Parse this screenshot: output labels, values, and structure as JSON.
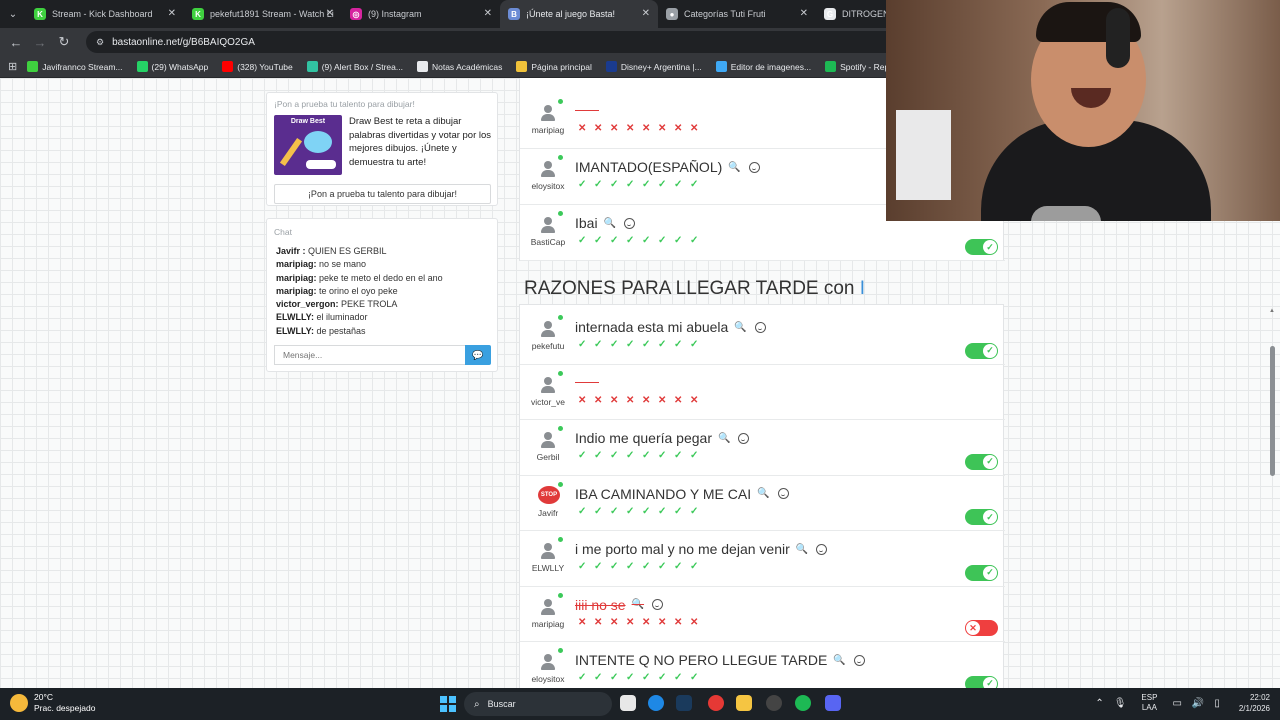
{
  "browser": {
    "tabs": [
      {
        "label": "Stream - Kick Dashboard",
        "fav_color": "#3fd13f",
        "fav_glyph": "K"
      },
      {
        "label": "pekefut1891 Stream - Watch Li",
        "fav_color": "#3fd13f",
        "fav_glyph": "K"
      },
      {
        "label": "(9) Instagram",
        "fav_color": "#d6249f",
        "fav_glyph": "◎"
      },
      {
        "label": "¡Únete al juego Basta!",
        "fav_color": "#6c8cd5",
        "fav_glyph": "B"
      },
      {
        "label": "Categorías Tuti Fruti",
        "fav_color": "#9aa0a6",
        "fav_glyph": "●"
      },
      {
        "label": "DITROGENO",
        "fav_color": "#e8eaed",
        "fav_glyph": "G"
      }
    ],
    "url": "bastaonline.net/g/B6BAIQO2GA",
    "bookmarks": [
      {
        "label": "Javifrannco Stream...",
        "color": "#3fd13f"
      },
      {
        "label": "(29) WhatsApp",
        "color": "#25d366"
      },
      {
        "label": "(328) YouTube",
        "color": "#ff0000"
      },
      {
        "label": "(9) Alert Box / Strea...",
        "color": "#31c3a2"
      },
      {
        "label": "Notas Académicas",
        "color": "#e8eaed"
      },
      {
        "label": "Página principal",
        "color": "#f0c23a"
      },
      {
        "label": "Disney+ Argentina |...",
        "color": "#1a3b8f"
      },
      {
        "label": "Editor de imagenes...",
        "color": "#3fa9f5"
      },
      {
        "label": "Spotify - Reproduct...",
        "color": "#1db954"
      }
    ]
  },
  "promo": {
    "title": "¡Pon a prueba tu talento para dibujar!",
    "image_title": "Draw Best",
    "text": "Draw Best te reta a dibujar palabras divertidas y votar por los mejores dibujos. ¡Únete y demuestra tu arte!",
    "button": "¡Pon a prueba tu talento para dibujar!"
  },
  "chat": {
    "title": "Chat",
    "messages": [
      {
        "user": "Javifr :",
        "text": " QUIEN ES GERBIL"
      },
      {
        "user": "maripiag:",
        "text": " no se mano"
      },
      {
        "user": "maripiag:",
        "text": " peke te meto el dedo en el ano"
      },
      {
        "user": "maripiag:",
        "text": " te orino el oyo peke"
      },
      {
        "user": "victor_vergon:",
        "text": " PEKE TROLA"
      },
      {
        "user": "ELWLLY:",
        "text": " el iluminador"
      },
      {
        "user": "ELWLLY:",
        "text": " de pestañas"
      }
    ],
    "placeholder": "Mensaje...",
    "send_icon": "chat-send-icon"
  },
  "section1": {
    "rows": [
      {
        "user": "maripiag",
        "answer": "",
        "empty": true,
        "votes": "xxxxxxxx",
        "toggle": null
      },
      {
        "user": "eloysitox",
        "answer": "IMANTADO(ESPAÑOL)",
        "votes": "vvvvvvvv",
        "toggle": null
      },
      {
        "user": "BastiCap",
        "answer": "Ibai",
        "votes": "vvvvvvvv",
        "toggle": "on"
      }
    ]
  },
  "category": {
    "title": "RAZONES PARA LLEGAR TARDE con",
    "letter": "I"
  },
  "section2": {
    "rows": [
      {
        "user": "pekefutu",
        "answer": "internada esta mi abuela",
        "votes": "vvvvvvvv",
        "toggle": "on",
        "avatar": "default"
      },
      {
        "user": "victor_ve",
        "answer": "",
        "empty": true,
        "votes": "xxxxxxxx",
        "toggle": null,
        "avatar": "default"
      },
      {
        "user": "Gerbil",
        "answer": "Indio me quería pegar",
        "votes": "vvvvvvvv",
        "toggle": "on",
        "avatar": "default"
      },
      {
        "user": "Javifr",
        "answer": "IBA CAMINANDO Y ME CAI",
        "votes": "vvvvvvvv",
        "toggle": "on",
        "avatar": "stop"
      },
      {
        "user": "ELWLLY",
        "answer": "i me porto mal y no me dejan venir",
        "votes": "vvvvvvvv",
        "toggle": "on",
        "avatar": "default"
      },
      {
        "user": "maripiag",
        "answer": "iiii no se",
        "invalid": true,
        "votes": "xxxxxxxx",
        "toggle": "off",
        "avatar": "default"
      },
      {
        "user": "eloysitox",
        "answer": "INTENTE Q NO PERO LLEGUE TARDE",
        "votes": "vvvvvvvv",
        "toggle": "on",
        "avatar": "default"
      }
    ]
  },
  "taskbar": {
    "temp": "20°C",
    "weather": "Prac. despejado",
    "search": "Buscar",
    "lang_top": "ESP",
    "lang_bottom": "LAA",
    "time": "22:02",
    "date": "2/1/2026"
  }
}
